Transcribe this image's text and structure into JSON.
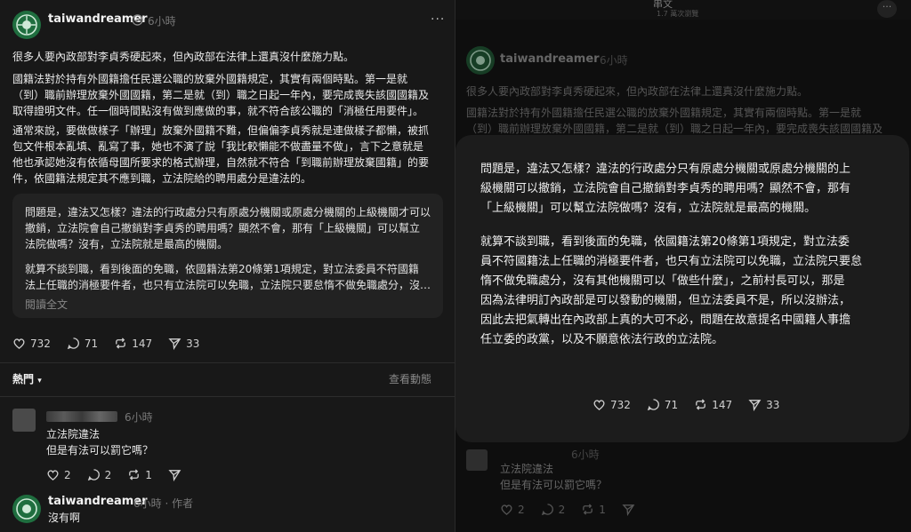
{
  "post": {
    "username": "taiwandreamer",
    "time": "6小時",
    "p1": "很多人要內政部對李貞秀硬起來，但內政部在法律上還真沒什麼施力點。",
    "p2": [
      "國籍法對於持有外國籍擔任民選公職的放棄外國籍規定，其實有兩個時點。第一是就",
      "（到）職前辦理放棄外國國籍，第二是就（到）職之日起一年內，要完成喪失該國國籍及",
      "取得證明文件。任一個時間點沒有做到應做的事，就不符合該公職的「消極任用要件」。"
    ],
    "p3": [
      "通常來說，要做做樣子「辦理」放棄外國籍不難，但偏偏李貞秀就是連做樣子都懶，被抓",
      "包文件根本亂填、亂寫了事，她也不演了說「我比較懶能不做盡量不做」，言下之意就是",
      "他也承認她沒有依循母國所要求的格式辦理，自然就不符合「到職前辦理放棄國籍」的要",
      "件，依國籍法規定其不應到職，立法院給的聘用處分是違法的。"
    ]
  },
  "quote": {
    "q1": [
      "問題是，違法又怎樣？違法的行政處分只有原處分機關或原處分機關的上級機關才可以",
      "撤銷，立法院會自己撤銷對李貞秀的聘用嗎？顯然不會，那有「上級機關」可以幫立",
      "法院做嗎？沒有，立法院就是最高的機關。"
    ],
    "q2": [
      "就算不談到職，看到後面的免職，依國籍法第20條第1項規定，對立法委員不符國籍",
      "法上任職的消極要件者，也只有立法院可以免職，立法院只要怠惰不做免職處分，沒…"
    ],
    "read_more": "閱讀全文"
  },
  "stats": {
    "likes": "732",
    "comments": "71",
    "reposts": "147",
    "shares": "33"
  },
  "sort": {
    "label": "熱門",
    "activity": "查看動態"
  },
  "comment1": {
    "time": "6小時",
    "lines": [
      "立法院違法",
      "但是有法可以罰它嗎？"
    ],
    "likes": "2",
    "comments": "2",
    "reposts": "1"
  },
  "reply": {
    "username": "taiwandreamer",
    "meta": "6小時 · 作者",
    "text": "沒有啊"
  },
  "right": {
    "topbar_title": "串文",
    "topbar_sub": "1.7 萬次瀏覽",
    "bg_username": "taiwandreamer",
    "bg_time": "6小時",
    "bg_p1": "很多人要內政部對李貞秀硬起來，但內政部在法律上還真沒什麼施力點。",
    "bg_p2a": "國籍法對於持有外國籍擔任民選公職的放棄外國籍規定，其實有兩個時點。第一是就",
    "bg_p2b": "（到）職前辦理放棄外國國籍，第二是就（到）職之日起一年內，要完成喪失該國國籍及",
    "modal_p1": [
      "問題是，違法又怎樣？違法的行政處分只有原處分機關或原處分機關的上",
      "級機關可以撤銷，立法院會自己撤銷對李貞秀的聘用嗎？顯然不會，那有",
      "「上級機關」可以幫立法院做嗎？沒有，立法院就是最高的機關。"
    ],
    "modal_p2": [
      "就算不談到職，看到後面的免職，依國籍法第20條第1項規定，對立法委",
      "員不符國籍法上任職的消極要件者，也只有立法院可以免職，立法院只要怠",
      "惰不做免職處分，沒有其他機關可以「做些什麼」，之前村長可以，那是",
      "因為法律明訂內政部是可以發動的機關，但立法委員不是，所以沒辦法，",
      "因此去把氣轉出在內政部上真的大可不必，問題在故意提名中國籍人事擔",
      "任立委的政黨，以及不願意依法行政的立法院。"
    ],
    "bg_c_time": "6小時",
    "bg_c_lines": [
      "立法院違法",
      "但是有法可以罰它嗎？"
    ],
    "bg_c_likes": "2",
    "bg_c_comments": "2",
    "bg_c_reposts": "1"
  }
}
